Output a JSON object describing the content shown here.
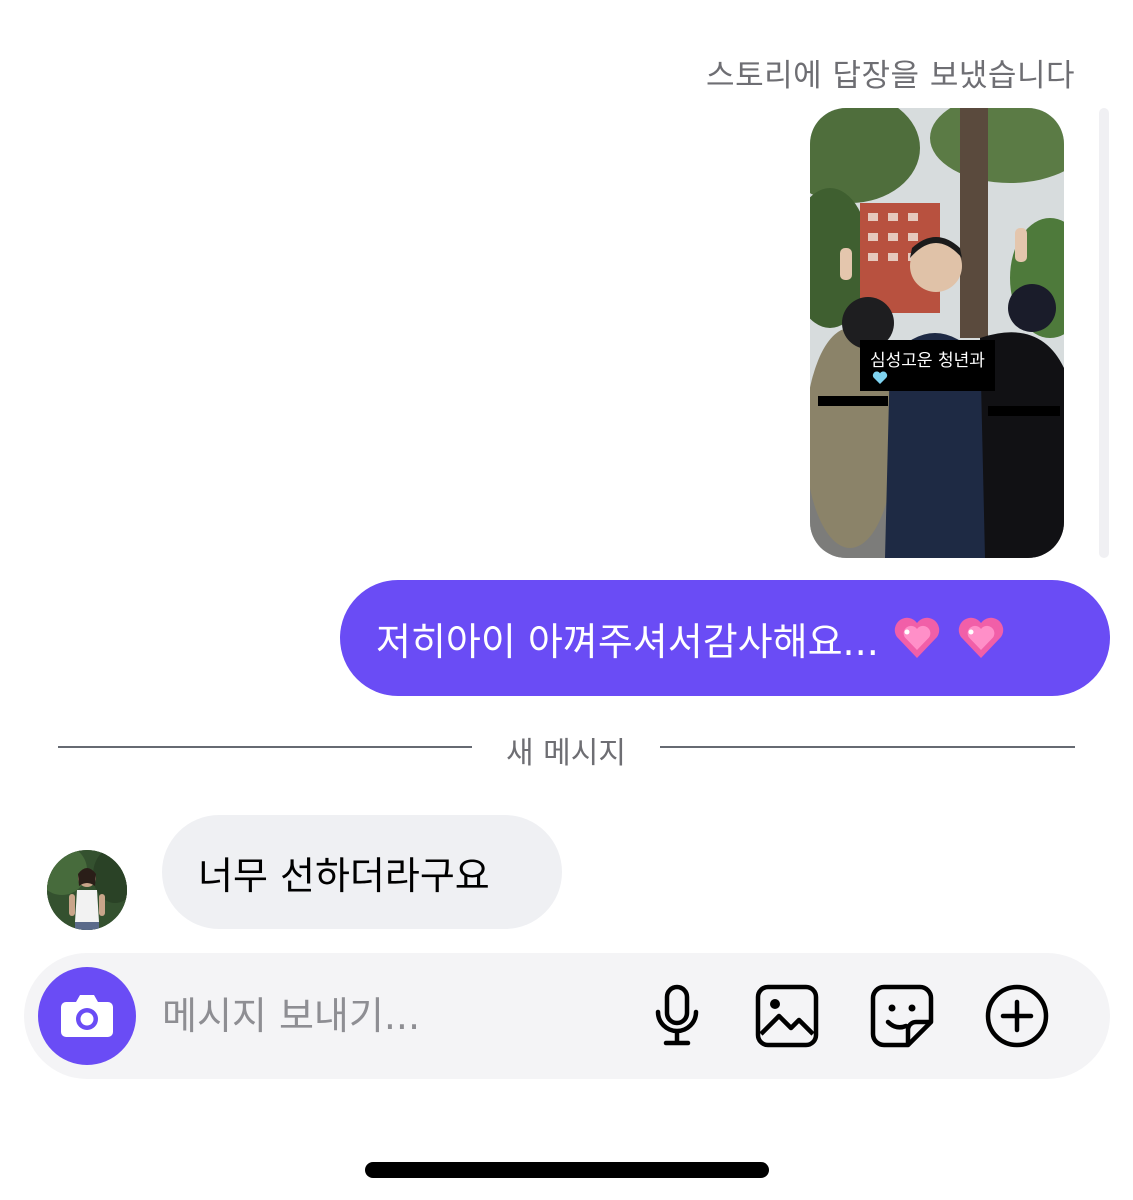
{
  "story": {
    "caption": "스토리에 답장을 보냈습니다",
    "sticker_text": "심성고운  청년과",
    "sticker_emoji": "light-blue-heart"
  },
  "messages": {
    "outgoing": {
      "text": "저히아이 아껴주셔서감사해요...",
      "emoji": [
        "sparkling-heart",
        "sparkling-heart"
      ]
    },
    "divider_label": "새 메시지",
    "incoming": {
      "text": "너무 선하더라구요"
    }
  },
  "composer": {
    "placeholder": "메시지 보내기..."
  },
  "colors": {
    "accent": "#6a4cf5",
    "incoming_bubble": "#eff0f3",
    "composer_bg": "#f4f4f6",
    "muted_text": "#6e6e73"
  },
  "icons": {
    "camera": "camera-icon",
    "mic": "microphone-icon",
    "gallery": "image-icon",
    "sticker": "sticker-icon",
    "more": "plus-circle-icon"
  }
}
